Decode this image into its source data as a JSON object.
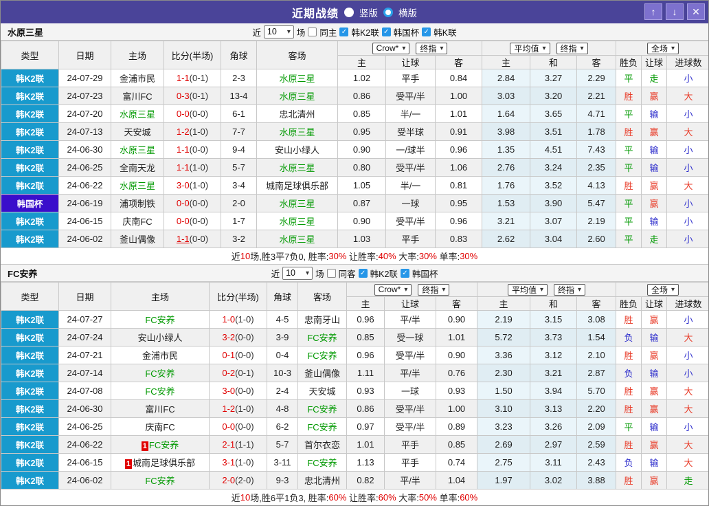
{
  "titlebar": {
    "title": "近期战绩",
    "radios": [
      {
        "label": "竖版",
        "selected": true
      },
      {
        "label": "横版",
        "selected": false
      }
    ],
    "buttons": [
      {
        "name": "up",
        "glyph": "↑"
      },
      {
        "name": "down",
        "glyph": "↓"
      },
      {
        "name": "close",
        "glyph": "✕"
      }
    ]
  },
  "icons": {
    "chevron": "▾",
    "check": "✓"
  },
  "colors": {
    "titlebar": "#4a4499",
    "league_k2": "#189acd",
    "league_cup": "#3a0ecb",
    "win_red": "#e83b28",
    "draw_green": "#009900",
    "lose_blue": "#2e2ecc",
    "score_red": "#e00000"
  },
  "sections": [
    {
      "team": "水原三星",
      "filter": {
        "near": "近",
        "count": "10",
        "games": "场",
        "same": "同主",
        "leagues": [
          "韩K2联",
          "韩国杯",
          "韩K联"
        ]
      },
      "columns": [
        "类型",
        "日期",
        "主场",
        "比分(半场)",
        "角球",
        "客场"
      ],
      "dropdowns": {
        "g1a": "Crow*",
        "g1b": "终指",
        "g2a": "平均值",
        "g2b": "终指",
        "g3": "全场"
      },
      "subcols": [
        "主",
        "让球",
        "客",
        "主",
        "和",
        "客",
        "胜负",
        "让球",
        "进球数"
      ],
      "rows": [
        {
          "lg": "韩K2联",
          "lgc": "k2",
          "date": "24-07-29",
          "home": "金浦市民",
          "hf": false,
          "hr": "",
          "score": "1-1",
          "half": "(0-1)",
          "ul": false,
          "corner": "2-3",
          "away": "水原三星",
          "af": true,
          "o1": "1.02",
          "h": "平手",
          "o2": "0.84",
          "a1": "2.84",
          "a2": "3.27",
          "a3": "2.29",
          "r1": "平",
          "c1": "g",
          "r2": "走",
          "c2": "g",
          "r3": "小",
          "c3": "b"
        },
        {
          "lg": "韩K2联",
          "lgc": "k2",
          "date": "24-07-23",
          "home": "富川FC",
          "hf": false,
          "hr": "",
          "score": "0-3",
          "half": "(0-1)",
          "ul": false,
          "corner": "13-4",
          "away": "水原三星",
          "af": true,
          "o1": "0.86",
          "h": "受平/半",
          "o2": "1.00",
          "a1": "3.03",
          "a2": "3.20",
          "a3": "2.21",
          "r1": "胜",
          "c1": "r",
          "r2": "赢",
          "c2": "r",
          "r3": "大",
          "c3": "r"
        },
        {
          "lg": "韩K2联",
          "lgc": "k2",
          "date": "24-07-20",
          "home": "水原三星",
          "hf": true,
          "hr": "",
          "score": "0-0",
          "half": "(0-0)",
          "ul": false,
          "corner": "6-1",
          "away": "忠北清州",
          "af": false,
          "o1": "0.85",
          "h": "半/一",
          "o2": "1.01",
          "a1": "1.64",
          "a2": "3.65",
          "a3": "4.71",
          "r1": "平",
          "c1": "g",
          "r2": "输",
          "c2": "b",
          "r3": "小",
          "c3": "b"
        },
        {
          "lg": "韩K2联",
          "lgc": "k2",
          "date": "24-07-13",
          "home": "天安城",
          "hf": false,
          "hr": "",
          "score": "1-2",
          "half": "(1-0)",
          "ul": false,
          "corner": "7-7",
          "away": "水原三星",
          "af": true,
          "o1": "0.95",
          "h": "受半球",
          "o2": "0.91",
          "a1": "3.98",
          "a2": "3.51",
          "a3": "1.78",
          "r1": "胜",
          "c1": "r",
          "r2": "赢",
          "c2": "r",
          "r3": "大",
          "c3": "r"
        },
        {
          "lg": "韩K2联",
          "lgc": "k2",
          "date": "24-06-30",
          "home": "水原三星",
          "hf": true,
          "hr": "",
          "score": "1-1",
          "half": "(0-0)",
          "ul": false,
          "corner": "9-4",
          "away": "安山小绿人",
          "af": false,
          "o1": "0.90",
          "h": "一/球半",
          "o2": "0.96",
          "a1": "1.35",
          "a2": "4.51",
          "a3": "7.43",
          "r1": "平",
          "c1": "g",
          "r2": "输",
          "c2": "b",
          "r3": "小",
          "c3": "b"
        },
        {
          "lg": "韩K2联",
          "lgc": "k2",
          "date": "24-06-25",
          "home": "全南天龙",
          "hf": false,
          "hr": "",
          "score": "1-1",
          "half": "(1-0)",
          "ul": false,
          "corner": "5-7",
          "away": "水原三星",
          "af": true,
          "o1": "0.80",
          "h": "受平/半",
          "o2": "1.06",
          "a1": "2.76",
          "a2": "3.24",
          "a3": "2.35",
          "r1": "平",
          "c1": "g",
          "r2": "输",
          "c2": "b",
          "r3": "小",
          "c3": "b"
        },
        {
          "lg": "韩K2联",
          "lgc": "k2",
          "date": "24-06-22",
          "home": "水原三星",
          "hf": true,
          "hr": "",
          "score": "3-0",
          "half": "(1-0)",
          "ul": false,
          "corner": "3-4",
          "away": "城南足球俱乐部",
          "af": false,
          "o1": "1.05",
          "h": "半/一",
          "o2": "0.81",
          "a1": "1.76",
          "a2": "3.52",
          "a3": "4.13",
          "r1": "胜",
          "c1": "r",
          "r2": "赢",
          "c2": "r",
          "r3": "大",
          "c3": "r"
        },
        {
          "lg": "韩国杯",
          "lgc": "cup",
          "date": "24-06-19",
          "home": "浦项制铁",
          "hf": false,
          "hr": "",
          "score": "0-0",
          "half": "(0-0)",
          "ul": false,
          "corner": "2-0",
          "away": "水原三星",
          "af": true,
          "o1": "0.87",
          "h": "一球",
          "o2": "0.95",
          "a1": "1.53",
          "a2": "3.90",
          "a3": "5.47",
          "r1": "平",
          "c1": "g",
          "r2": "赢",
          "c2": "r",
          "r3": "小",
          "c3": "b"
        },
        {
          "lg": "韩K2联",
          "lgc": "k2",
          "date": "24-06-15",
          "home": "庆南FC",
          "hf": false,
          "hr": "",
          "score": "0-0",
          "half": "(0-0)",
          "ul": false,
          "corner": "1-7",
          "away": "水原三星",
          "af": true,
          "o1": "0.90",
          "h": "受平/半",
          "o2": "0.96",
          "a1": "3.21",
          "a2": "3.07",
          "a3": "2.19",
          "r1": "平",
          "c1": "g",
          "r2": "输",
          "c2": "b",
          "r3": "小",
          "c3": "b"
        },
        {
          "lg": "韩K2联",
          "lgc": "k2",
          "date": "24-06-02",
          "home": "釜山偶像",
          "hf": false,
          "hr": "",
          "score": "1-1",
          "half": "(0-0)",
          "ul": true,
          "corner": "3-2",
          "away": "水原三星",
          "af": true,
          "o1": "1.03",
          "h": "平手",
          "o2": "0.83",
          "a1": "2.62",
          "a2": "3.04",
          "a3": "2.60",
          "r1": "平",
          "c1": "g",
          "r2": "走",
          "c2": "g",
          "r3": "小",
          "c3": "b"
        }
      ],
      "summary": {
        "t1": "近",
        "v0": "10",
        "t2": "场,胜3平7负0, 胜率:",
        "v1": "30%",
        "t3": " 让胜率:",
        "v2": "40%",
        "t4": " 大率:",
        "v3": "30%",
        "t5": " 单率:",
        "v4": "30%"
      }
    },
    {
      "team": "FC安养",
      "filter": {
        "near": "近",
        "count": "10",
        "games": "场",
        "same": "同客",
        "leagues": [
          "韩K2联",
          "韩国杯"
        ]
      },
      "columns": [
        "类型",
        "日期",
        "主场",
        "比分(半场)",
        "角球",
        "客场"
      ],
      "dropdowns": {
        "g1a": "Crow*",
        "g1b": "终指",
        "g2a": "平均值",
        "g2b": "终指",
        "g3": "全场"
      },
      "subcols": [
        "主",
        "让球",
        "客",
        "主",
        "和",
        "客",
        "胜负",
        "让球",
        "进球数"
      ],
      "rows": [
        {
          "lg": "韩K2联",
          "lgc": "k2",
          "date": "24-07-27",
          "home": "FC安养",
          "hf": true,
          "hr": "",
          "score": "1-0",
          "half": "(1-0)",
          "ul": false,
          "corner": "4-5",
          "away": "忠南牙山",
          "af": false,
          "o1": "0.96",
          "h": "平/半",
          "o2": "0.90",
          "a1": "2.19",
          "a2": "3.15",
          "a3": "3.08",
          "r1": "胜",
          "c1": "r",
          "r2": "赢",
          "c2": "r",
          "r3": "小",
          "c3": "b"
        },
        {
          "lg": "韩K2联",
          "lgc": "k2",
          "date": "24-07-24",
          "home": "安山小绿人",
          "hf": false,
          "hr": "",
          "score": "3-2",
          "half": "(0-0)",
          "ul": false,
          "corner": "3-9",
          "away": "FC安养",
          "af": true,
          "o1": "0.85",
          "h": "受一球",
          "o2": "1.01",
          "a1": "5.72",
          "a2": "3.73",
          "a3": "1.54",
          "r1": "负",
          "c1": "b",
          "r2": "输",
          "c2": "b",
          "r3": "大",
          "c3": "r"
        },
        {
          "lg": "韩K2联",
          "lgc": "k2",
          "date": "24-07-21",
          "home": "金浦市民",
          "hf": false,
          "hr": "",
          "score": "0-1",
          "half": "(0-0)",
          "ul": false,
          "corner": "0-4",
          "away": "FC安养",
          "af": true,
          "o1": "0.96",
          "h": "受平/半",
          "o2": "0.90",
          "a1": "3.36",
          "a2": "3.12",
          "a3": "2.10",
          "r1": "胜",
          "c1": "r",
          "r2": "赢",
          "c2": "r",
          "r3": "小",
          "c3": "b"
        },
        {
          "lg": "韩K2联",
          "lgc": "k2",
          "date": "24-07-14",
          "home": "FC安养",
          "hf": true,
          "hr": "",
          "score": "0-2",
          "half": "(0-1)",
          "ul": false,
          "corner": "10-3",
          "away": "釜山偶像",
          "af": false,
          "o1": "1.11",
          "h": "平/半",
          "o2": "0.76",
          "a1": "2.30",
          "a2": "3.21",
          "a3": "2.87",
          "r1": "负",
          "c1": "b",
          "r2": "输",
          "c2": "b",
          "r3": "小",
          "c3": "b"
        },
        {
          "lg": "韩K2联",
          "lgc": "k2",
          "date": "24-07-08",
          "home": "FC安养",
          "hf": true,
          "hr": "",
          "score": "3-0",
          "half": "(0-0)",
          "ul": false,
          "corner": "2-4",
          "away": "天安城",
          "af": false,
          "o1": "0.93",
          "h": "一球",
          "o2": "0.93",
          "a1": "1.50",
          "a2": "3.94",
          "a3": "5.70",
          "r1": "胜",
          "c1": "r",
          "r2": "赢",
          "c2": "r",
          "r3": "大",
          "c3": "r"
        },
        {
          "lg": "韩K2联",
          "lgc": "k2",
          "date": "24-06-30",
          "home": "富川FC",
          "hf": false,
          "hr": "",
          "score": "1-2",
          "half": "(1-0)",
          "ul": false,
          "corner": "4-8",
          "away": "FC安养",
          "af": true,
          "o1": "0.86",
          "h": "受平/半",
          "o2": "1.00",
          "a1": "3.10",
          "a2": "3.13",
          "a3": "2.20",
          "r1": "胜",
          "c1": "r",
          "r2": "赢",
          "c2": "r",
          "r3": "大",
          "c3": "r"
        },
        {
          "lg": "韩K2联",
          "lgc": "k2",
          "date": "24-06-25",
          "home": "庆南FC",
          "hf": false,
          "hr": "",
          "score": "0-0",
          "half": "(0-0)",
          "ul": false,
          "corner": "6-2",
          "away": "FC安养",
          "af": true,
          "o1": "0.97",
          "h": "受平/半",
          "o2": "0.89",
          "a1": "3.23",
          "a2": "3.26",
          "a3": "2.09",
          "r1": "平",
          "c1": "g",
          "r2": "输",
          "c2": "b",
          "r3": "小",
          "c3": "b"
        },
        {
          "lg": "韩K2联",
          "lgc": "k2",
          "date": "24-06-22",
          "home": "FC安养",
          "hf": true,
          "hr": "1",
          "score": "2-1",
          "half": "(1-1)",
          "ul": false,
          "corner": "5-7",
          "away": "首尔衣恋",
          "af": false,
          "o1": "1.01",
          "h": "平手",
          "o2": "0.85",
          "a1": "2.69",
          "a2": "2.97",
          "a3": "2.59",
          "r1": "胜",
          "c1": "r",
          "r2": "赢",
          "c2": "r",
          "r3": "大",
          "c3": "r"
        },
        {
          "lg": "韩K2联",
          "lgc": "k2",
          "date": "24-06-15",
          "home": "城南足球俱乐部",
          "hf": false,
          "hr": "1",
          "score": "3-1",
          "half": "(1-0)",
          "ul": false,
          "corner": "3-11",
          "away": "FC安养",
          "af": true,
          "o1": "1.13",
          "h": "平手",
          "o2": "0.74",
          "a1": "2.75",
          "a2": "3.11",
          "a3": "2.43",
          "r1": "负",
          "c1": "b",
          "r2": "输",
          "c2": "b",
          "r3": "大",
          "c3": "r"
        },
        {
          "lg": "韩K2联",
          "lgc": "k2",
          "date": "24-06-02",
          "home": "FC安养",
          "hf": true,
          "hr": "",
          "score": "2-0",
          "half": "(2-0)",
          "ul": false,
          "corner": "9-3",
          "away": "忠北清州",
          "af": false,
          "o1": "0.82",
          "h": "平/半",
          "o2": "1.04",
          "a1": "1.97",
          "a2": "3.02",
          "a3": "3.88",
          "r1": "胜",
          "c1": "r",
          "r2": "赢",
          "c2": "r",
          "r3": "走",
          "c3": "g"
        }
      ],
      "summary": {
        "t1": "近",
        "v0": "10",
        "t2": "场,胜6平1负3, 胜率:",
        "v1": "60%",
        "t3": " 让胜率:",
        "v2": "60%",
        "t4": " 大率:",
        "v3": "50%",
        "t5": " 单率:",
        "v4": "60%"
      }
    }
  ]
}
